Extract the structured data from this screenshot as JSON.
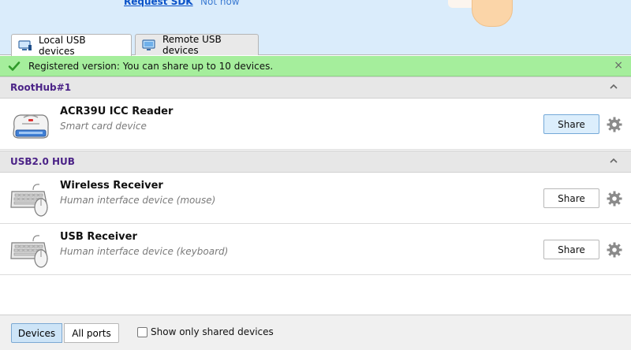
{
  "promo": {
    "link_label": "Request SDK",
    "dismiss_label": "Not now"
  },
  "tabs": [
    {
      "label": "Local USB devices",
      "icon": "computer-usb-icon",
      "active": true
    },
    {
      "label": "Remote USB devices",
      "icon": "monitor-network-icon",
      "active": false
    }
  ],
  "notice": {
    "text": "Registered version: You can share up to 10 devices.",
    "close_glyph": "×",
    "color": "#a5ee9c"
  },
  "groups": [
    {
      "title": "RootHub#1",
      "devices": [
        {
          "name": "ACR39U ICC Reader",
          "description": "Smart card device",
          "icon": "card-reader-icon",
          "action_label": "Share"
        }
      ]
    },
    {
      "title": "USB2.0 HUB",
      "devices": [
        {
          "name": "Wireless Receiver",
          "description": "Human interface device (mouse)",
          "icon": "keyboard-mouse-icon",
          "action_label": "Share"
        },
        {
          "name": "USB Receiver",
          "description": "Human interface device (keyboard)",
          "icon": "keyboard-mouse-icon",
          "action_label": "Share"
        }
      ]
    }
  ],
  "bottom": {
    "view_devices_label": "Devices",
    "view_ports_label": "All ports",
    "filter_label": "Show only shared devices",
    "filter_checked": false
  }
}
